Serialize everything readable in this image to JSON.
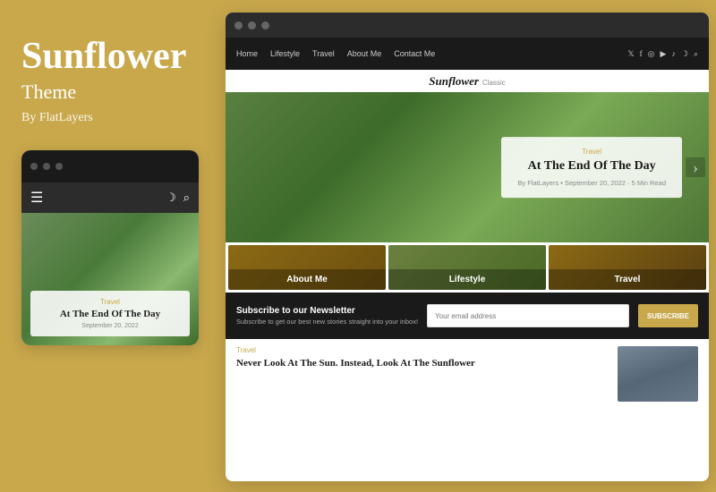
{
  "left": {
    "title": "Sunflower",
    "subtitle": "Theme",
    "by": "By FlatLayers",
    "mobile": {
      "dots": [
        "dot1",
        "dot2",
        "dot3"
      ],
      "hero_tag": "Travel",
      "hero_title": "At The End Of The Day",
      "hero_date": "September 20, 2022"
    }
  },
  "desktop": {
    "window_dots": [
      "dot1",
      "dot2",
      "dot3"
    ],
    "nav": {
      "links": [
        "Home",
        "Lifestyle",
        "Travel",
        "About Me",
        "Contact Me"
      ]
    },
    "site_name": "Sunflower",
    "site_name_sub": "Classic",
    "hero": {
      "tag": "Travel",
      "title": "At The End Of The Day",
      "meta": "By FlatLayers  •  September 20, 2022 · 5 Min Read"
    },
    "categories": [
      {
        "label": "About Me"
      },
      {
        "label": "Lifestyle"
      },
      {
        "label": "Travel"
      }
    ],
    "newsletter": {
      "title": "Subscribe to our Newsletter",
      "subtitle": "Subscribe to get our best new stories straight into your inbox!",
      "placeholder": "Your email address",
      "button": "SUBSCRIBE"
    },
    "article": {
      "tag": "Travel",
      "title": "Never Look At The Sun. Instead, Look At The Sunflower"
    }
  }
}
